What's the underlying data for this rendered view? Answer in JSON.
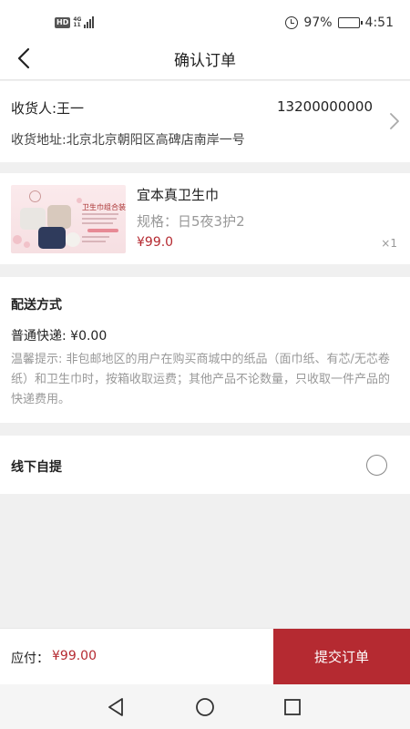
{
  "status_bar": {
    "hd": "HD",
    "network_top": "4G",
    "network_bottom": "11",
    "battery": "97%",
    "time": "4:51"
  },
  "header": {
    "title": "确认订单"
  },
  "address": {
    "recipient": "收货人:王一",
    "phone": "13200000000",
    "address": "收货地址:北京北京朝阳区高碑店南岸一号"
  },
  "product": {
    "name": "宜本真卫生巾",
    "spec": "规格：日5夜3护2",
    "price": "¥99.0",
    "quantity": "×1",
    "image_headline": "卫生巾组合装"
  },
  "delivery": {
    "title": "配送方式",
    "type": "普通快递: ¥0.00",
    "tip": "温馨提示: 非包邮地区的用户在购买商城中的纸品（面巾纸、有芯/无芯卷纸）和卫生巾时，按箱收取运费；其他产品不论数量，只收取一件产品的快递费用。"
  },
  "pickup": {
    "label": "线下自提",
    "selected": false
  },
  "footer": {
    "pay_label": "应付：",
    "pay_amount": "¥99.00",
    "submit_label": "提交订单"
  },
  "colors": {
    "accent": "#b52a31",
    "background": "#f0f0f0",
    "muted_text": "#999999"
  },
  "icons": {
    "back": "chevron-left-icon",
    "address_arrow": "chevron-right-icon",
    "alarm": "alarm-clock-icon",
    "battery": "battery-icon",
    "signal": "signal-icon",
    "sys_back": "triangle-back-icon",
    "sys_home": "circle-home-icon",
    "sys_recent": "square-recent-icon"
  }
}
